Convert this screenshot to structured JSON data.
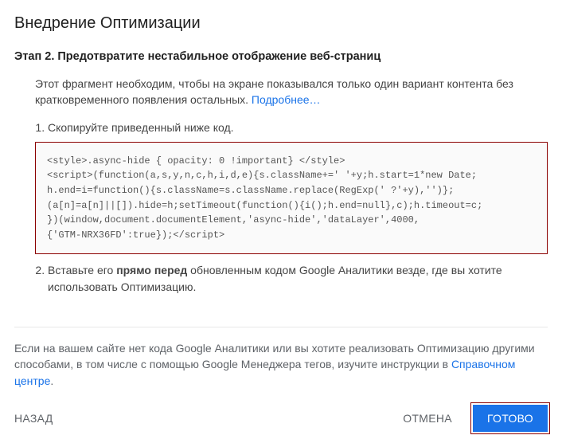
{
  "dialog": {
    "title": "Внедрение Оптимизации"
  },
  "step": {
    "heading": "Этап 2. Предотвратите нестабильное отображение веб-страниц",
    "intro_prefix": "Этот фрагмент необходим, чтобы на экране показывался только один вариант контента без кратковременного появления остальных. ",
    "intro_link": "Подробнее…",
    "item1": "Скопируйте приведенный ниже код.",
    "code": "<style>.async-hide { opacity: 0 !important} </style>\n<script>(function(a,s,y,n,c,h,i,d,e){s.className+=' '+y;h.start=1*new Date;\nh.end=i=function(){s.className=s.className.replace(RegExp(' ?'+y),'')};\n(a[n]=a[n]||[]).hide=h;setTimeout(function(){i();h.end=null},c);h.timeout=c;\n})(window,document.documentElement,'async-hide','dataLayer',4000,\n{'GTM-NRX36FD':true});</script>",
    "item2_prefix": "Вставьте его ",
    "item2_bold": "прямо перед",
    "item2_suffix": " обновленным кодом Google Аналитики везде, где вы хотите использовать Оптимизацию."
  },
  "help": {
    "prefix": "Если на вашем сайте нет кода Google Аналитики или вы хотите реализовать Оптимизацию другими способами, в том числе с помощью Google Менеджера тегов, изучите инструкции в ",
    "link": "Справочном центре",
    "suffix": "."
  },
  "actions": {
    "back": "НАЗАД",
    "cancel": "ОТМЕНА",
    "done": "ГОТОВО"
  }
}
